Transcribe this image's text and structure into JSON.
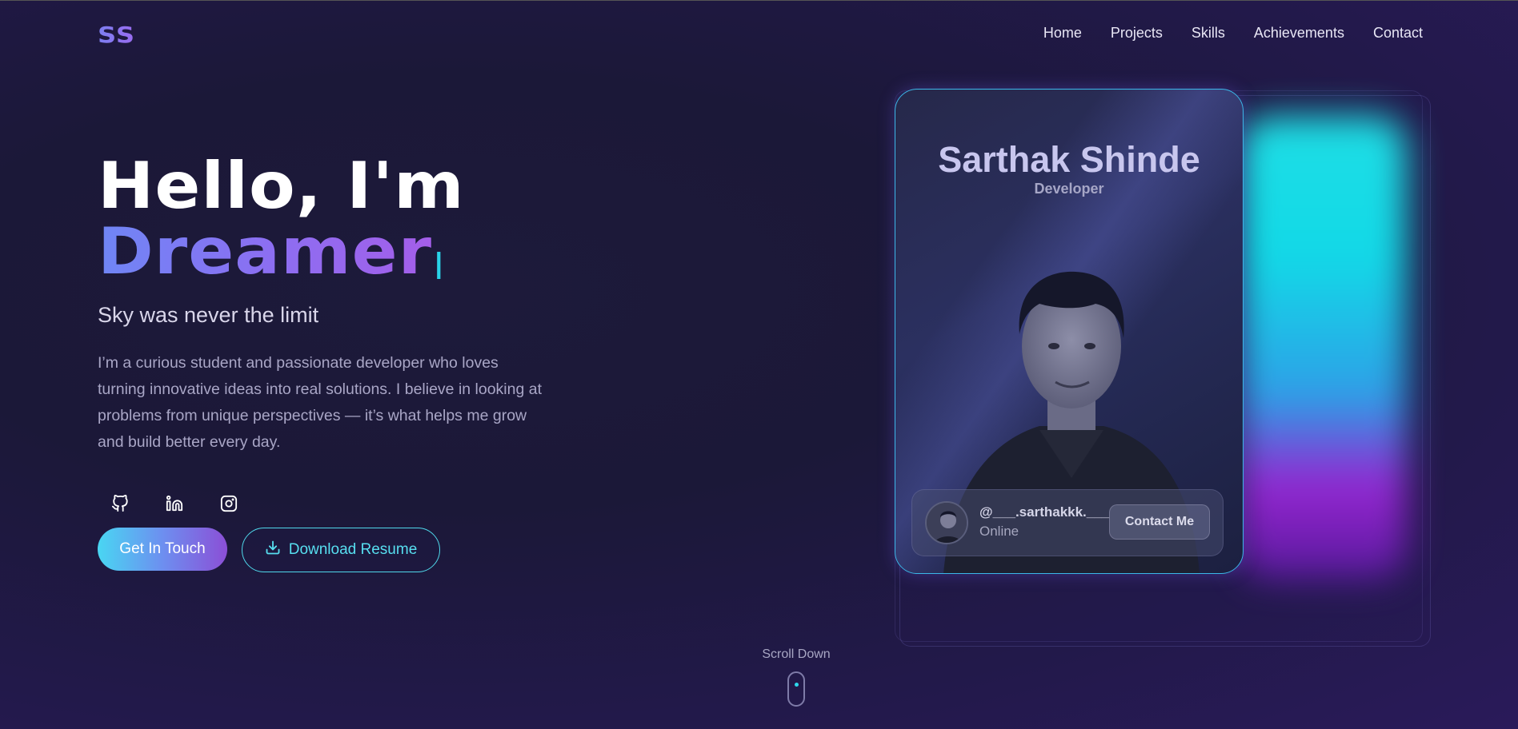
{
  "nav": {
    "logo": "SS",
    "links": [
      "Home",
      "Projects",
      "Skills",
      "Achievements",
      "Contact"
    ]
  },
  "hero": {
    "greeting": "Hello, I'm",
    "role": "Dreamer",
    "tagline": "Sky was never the limit",
    "bio": "I’m a curious student and passionate developer who loves turning innovative ideas into real solutions. I believe in looking at problems from unique perspectives — it’s what helps me grow and build better every day.",
    "socials": [
      "github-icon",
      "linkedin-icon",
      "instagram-icon"
    ],
    "primary_button": "Get In Touch",
    "secondary_button": "Download Resume"
  },
  "card": {
    "name": "Sarthak Shinde",
    "role": "Developer",
    "handle": "@___.sarthakkk.___",
    "status": "Online",
    "contact_button": "Contact Me"
  },
  "scroll": {
    "label": "Scroll Down"
  },
  "colors": {
    "accent_cyan": "#49d6f2",
    "accent_purple": "#8b4fd6",
    "background": "#1d1a3a"
  }
}
